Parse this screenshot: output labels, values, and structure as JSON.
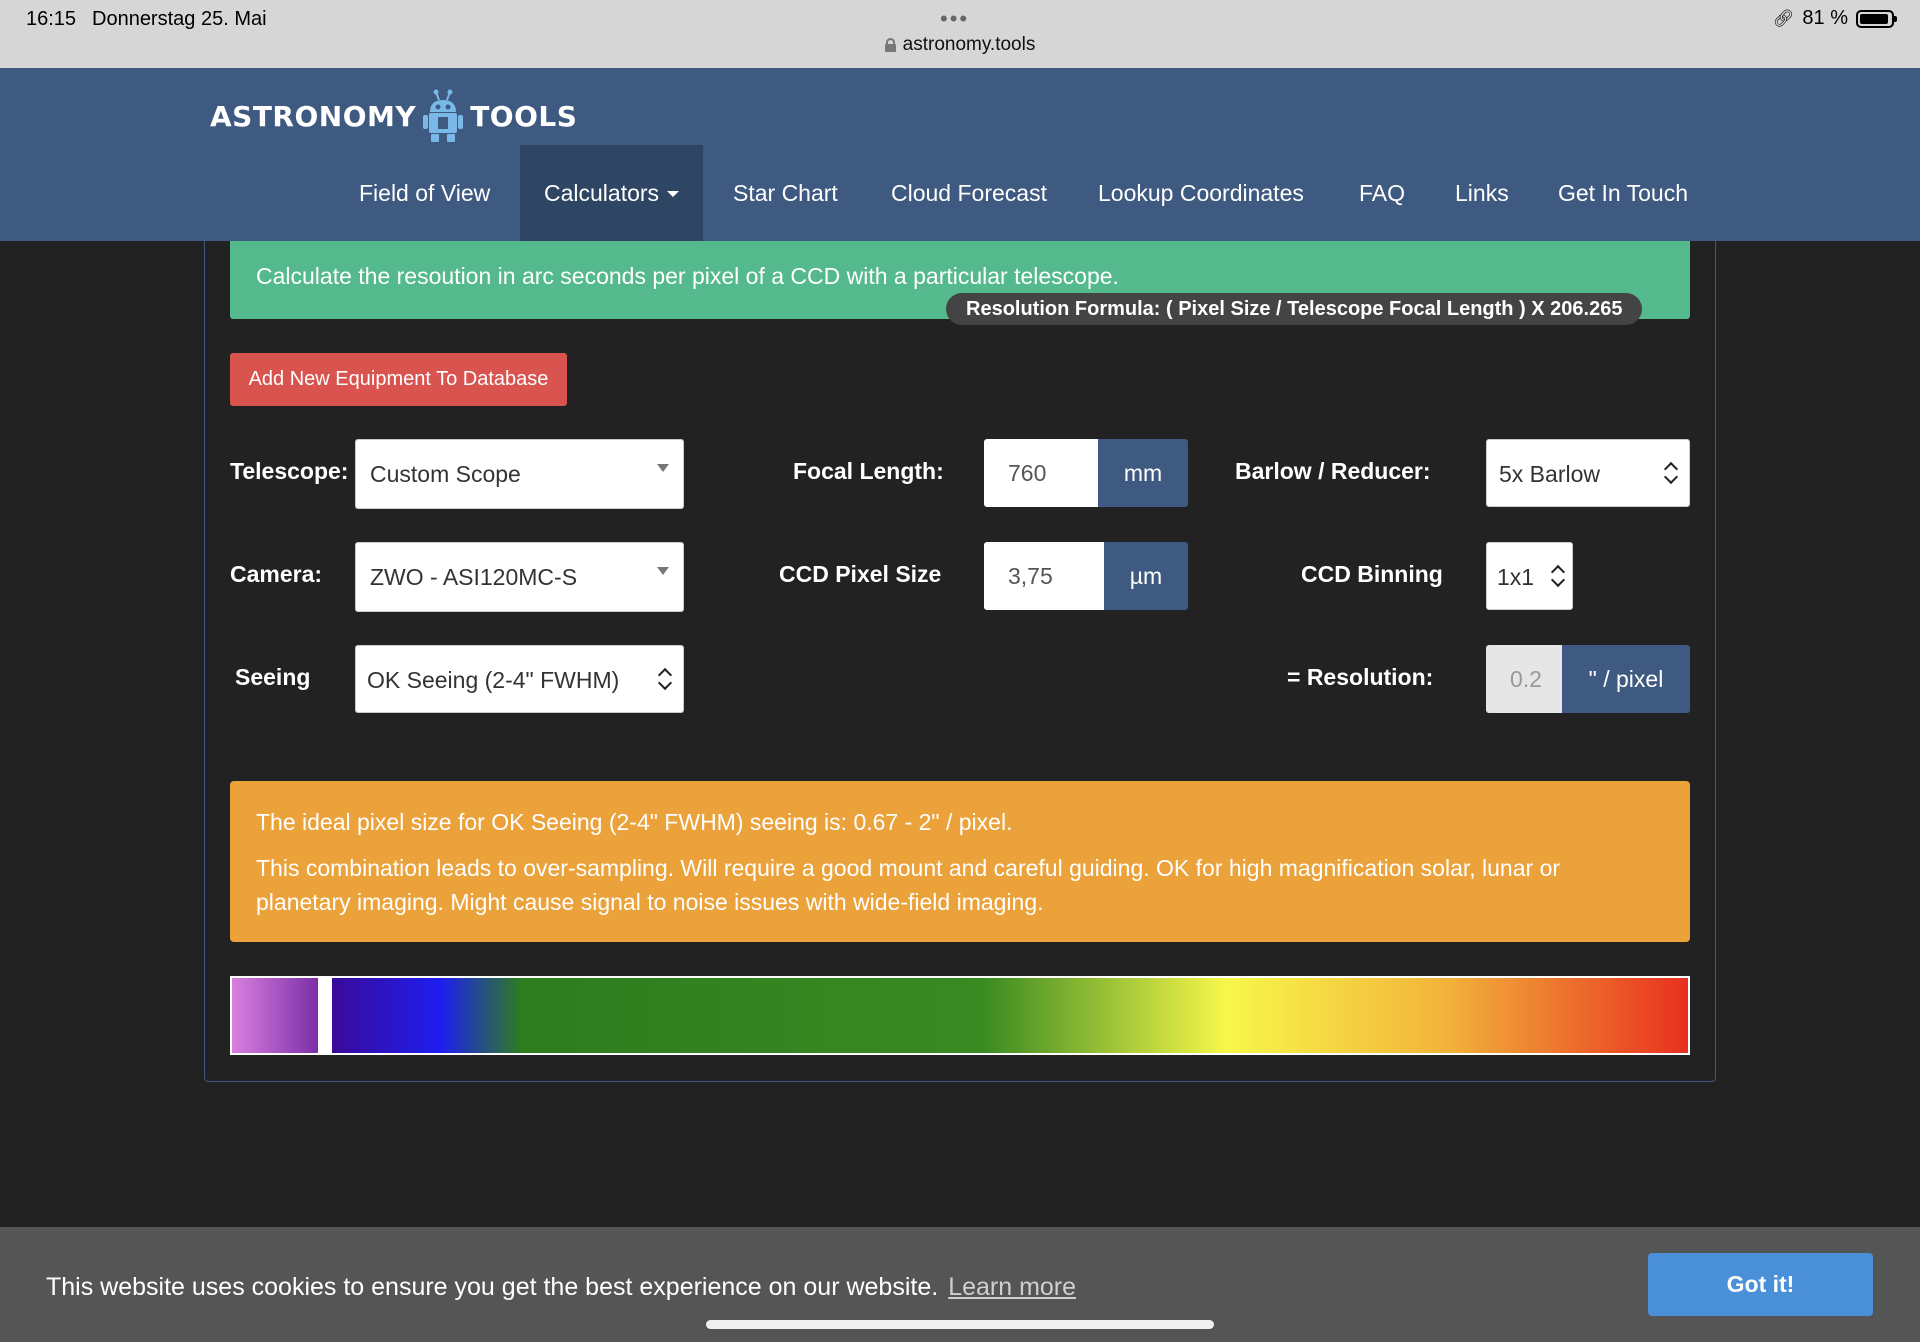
{
  "status_bar": {
    "time": "16:15",
    "date": "Donnerstag 25. Mai",
    "url": "astronomy.tools",
    "battery": "81 %",
    "dots": "•••"
  },
  "logo": {
    "left": "ASTRONOMY",
    "right": "TOOLS"
  },
  "nav": {
    "items": [
      {
        "label": "Field of View"
      },
      {
        "label": "Calculators"
      },
      {
        "label": "Star Chart"
      },
      {
        "label": "Cloud Forecast"
      },
      {
        "label": "Lookup Coordinates"
      },
      {
        "label": "FAQ"
      },
      {
        "label": "Links"
      },
      {
        "label": "Get In Touch"
      }
    ]
  },
  "intro": {
    "text": "Calculate the resoution in arc seconds per pixel of a CCD with a particular telescope.",
    "formula": "Resolution Formula:  (  Pixel Size  /  Telescope Focal Length  )  X 206.265"
  },
  "add_button": "Add New Equipment To Database",
  "form": {
    "telescope_label": "Telescope:",
    "telescope_value": "Custom Scope",
    "focal_label": "Focal Length:",
    "focal_value": "760",
    "focal_unit": "mm",
    "barlow_label": "Barlow / Reducer:",
    "barlow_value": "5x Barlow",
    "camera_label": "Camera:",
    "camera_value": "ZWO - ASI120MC-S",
    "pixel_label": "CCD Pixel Size",
    "pixel_value": "3,75",
    "pixel_unit": "µm",
    "binning_label": "CCD Binning",
    "binning_value": "1x1",
    "seeing_label": "Seeing",
    "seeing_value": "OK Seeing (2-4\" FWHM)",
    "resolution_label": "=  Resolution:",
    "resolution_value": "0.2",
    "resolution_unit": "\" / pixel"
  },
  "warning": {
    "line1": "The ideal pixel size for OK Seeing (2-4\" FWHM) seeing is: 0.67 - 2\" / pixel.",
    "line2": "This combination leads to over-sampling. Will require a good mount and careful guiding. OK for high magnification solar, lunar or planetary imaging. Might cause signal to noise issues with wide-field imaging."
  },
  "spectrum_colors": [
    "#d97fe0",
    "#7b2fa8",
    "#3a0a9a",
    "#1e1ef0",
    "#2d7d1f",
    "#3a8a22",
    "#f7f74a",
    "#f2b43a",
    "#e83020"
  ],
  "cookie": {
    "message": "This website uses cookies to ensure you get the best experience on our website.",
    "learn_more": "Learn more",
    "button": "Got it!"
  }
}
